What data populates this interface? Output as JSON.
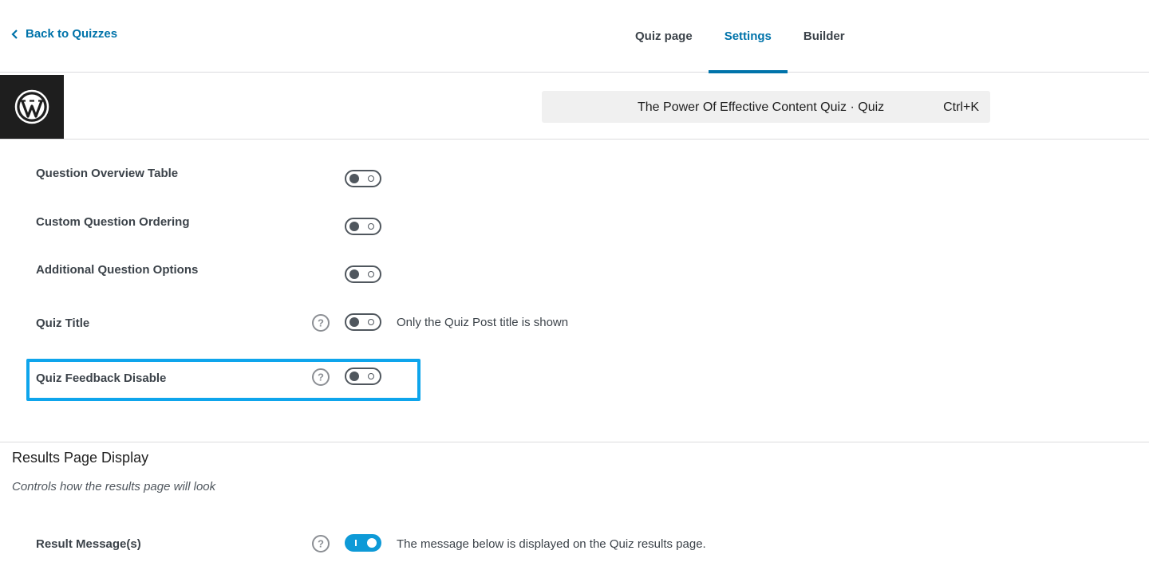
{
  "topbar": {
    "back_label": "Back to Quizzes",
    "tabs": [
      {
        "label": "Quiz page",
        "active": false
      },
      {
        "label": "Settings",
        "active": true
      },
      {
        "label": "Builder",
        "active": false
      }
    ]
  },
  "editor": {
    "logo_icon": "wordpress-icon",
    "command_title": "The Power Of Effective Content Quiz · Quiz",
    "command_shortcut": "Ctrl+K"
  },
  "settings": [
    {
      "label": "Question Overview Table",
      "help": false,
      "enabled": false,
      "description": ""
    },
    {
      "label": "Custom Question Ordering",
      "help": false,
      "enabled": false,
      "description": ""
    },
    {
      "label": "Additional Question Options",
      "help": false,
      "enabled": false,
      "description": ""
    },
    {
      "label": "Quiz Title",
      "help": true,
      "enabled": false,
      "description": "Only the Quiz Post title is shown"
    },
    {
      "label": "Quiz Feedback Disable",
      "help": true,
      "enabled": false,
      "description": "",
      "highlighted": true
    }
  ],
  "results_section": {
    "title": "Results Page Display",
    "subtitle": "Controls how the results page will look",
    "settings": [
      {
        "label": "Result Message(s)",
        "help": true,
        "enabled": true,
        "description": "The message below is displayed on the Quiz results page."
      }
    ]
  },
  "colors": {
    "accent": "#0073aa",
    "toggle_on": "#0e9ad7",
    "highlight": "#0ea5ec"
  }
}
